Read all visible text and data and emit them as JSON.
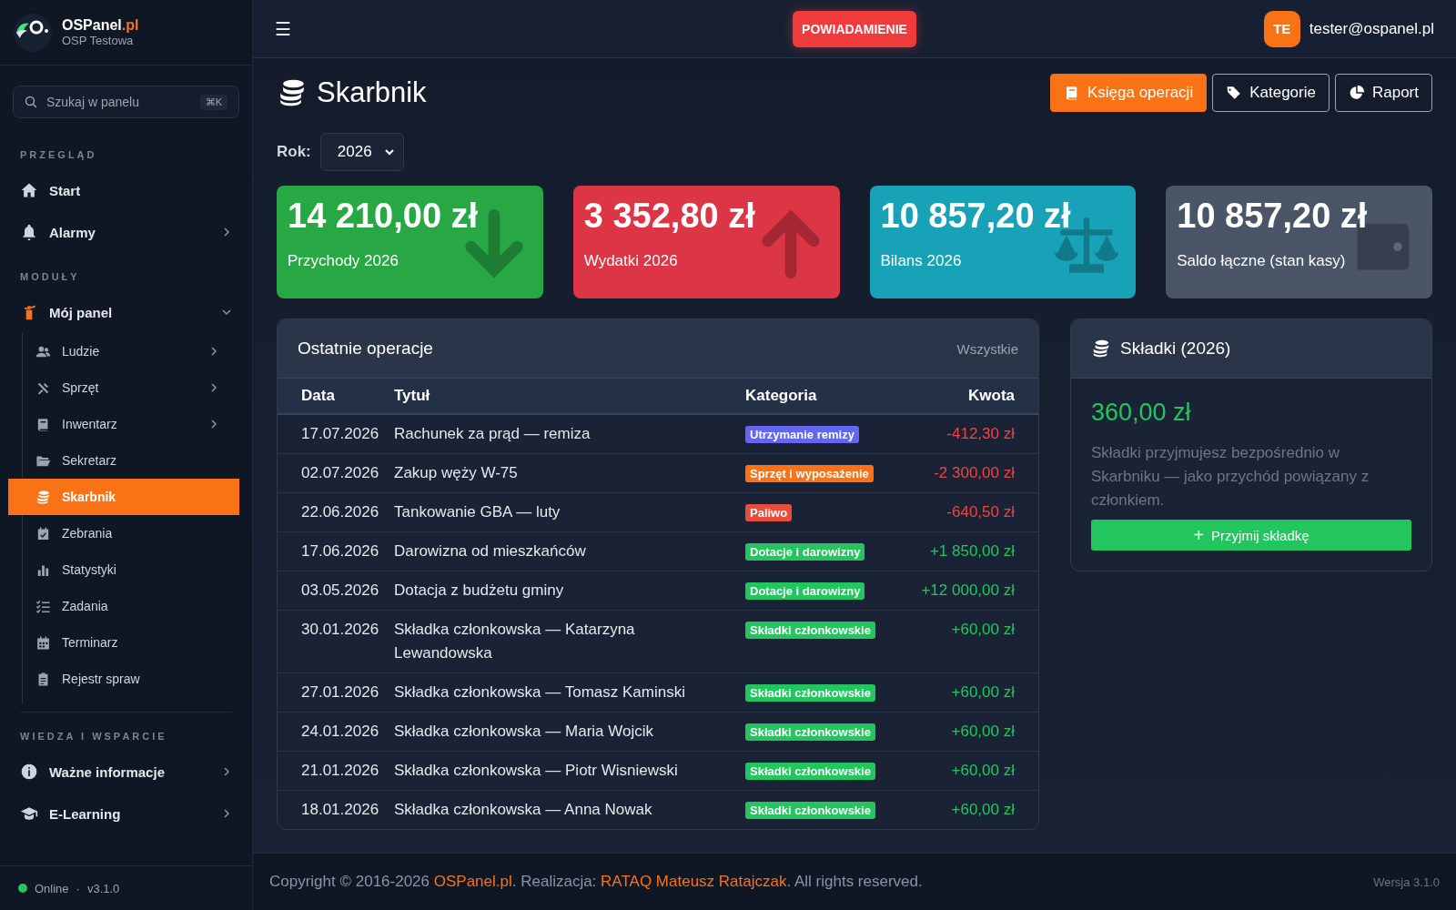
{
  "brand": {
    "name": "OSPanel",
    "tld": ".pl",
    "unit": "OSP Testowa"
  },
  "search": {
    "placeholder": "Szukaj w panelu",
    "shortcut": "⌘K"
  },
  "sidebar": {
    "sections": [
      {
        "heading": "PRZEGLĄD",
        "items": [
          {
            "label": "Start",
            "selected": false,
            "chevron": false
          },
          {
            "label": "Alarmy",
            "selected": false,
            "chevron": true
          }
        ]
      },
      {
        "heading": "MODUŁY",
        "items": [
          {
            "label": "Mój panel",
            "selected": false,
            "chevron": true,
            "expanded": true,
            "children": [
              {
                "label": "Ludzie",
                "selected": false,
                "chevron": true
              },
              {
                "label": "Sprzęt",
                "selected": false,
                "chevron": true
              },
              {
                "label": "Inwentarz",
                "selected": false,
                "chevron": true
              },
              {
                "label": "Sekretarz",
                "selected": false,
                "chevron": false
              },
              {
                "label": "Skarbnik",
                "selected": true,
                "chevron": false
              },
              {
                "label": "Zebrania",
                "selected": false,
                "chevron": false
              },
              {
                "label": "Statystyki",
                "selected": false,
                "chevron": false
              },
              {
                "label": "Zadania",
                "selected": false,
                "chevron": false
              },
              {
                "label": "Terminarz",
                "selected": false,
                "chevron": false
              },
              {
                "label": "Rejestr spraw",
                "selected": false,
                "chevron": false
              }
            ]
          }
        ]
      },
      {
        "heading": "WIEDZA I WSPARCIE",
        "items": [
          {
            "label": "Ważne informacje",
            "selected": false,
            "chevron": true
          },
          {
            "label": "E-Learning",
            "selected": false,
            "chevron": true
          }
        ]
      }
    ]
  },
  "status": {
    "label": "Online",
    "online": true,
    "separator": "·",
    "version": "v3.1.0"
  },
  "topbar": {
    "menu": "☰",
    "notification": "POWIADAMIENIE",
    "avatar": "TE",
    "user": "tester@ospanel.pl"
  },
  "page": {
    "title": "Skarbnik",
    "actions": [
      {
        "label": "Księga operacji",
        "primary": true
      },
      {
        "label": "Kategorie",
        "primary": false
      },
      {
        "label": "Raport",
        "primary": false
      }
    ],
    "year_label": "Rok:",
    "year": "2026"
  },
  "stats": [
    {
      "value": "14 210,00 zł",
      "label": "Przychody 2026",
      "color": "#28a745"
    },
    {
      "value": "3 352,80 zł",
      "label": "Wydatki 2026",
      "color": "#dc3545"
    },
    {
      "value": "10 857,20 zł",
      "label": "Bilans 2026",
      "color": "#17a2b8"
    },
    {
      "value": "10 857,20 zł",
      "label": "Saldo łączne (stan kasy)",
      "color": "#4a5568"
    }
  ],
  "operations": {
    "title": "Ostatnie operacje",
    "link": "Wszystkie",
    "columns": [
      "Data",
      "Tytuł",
      "Kategoria",
      "Kwota"
    ],
    "rows": [
      {
        "date": "17.07.2026",
        "title": "Rachunek za prąd — remiza",
        "category": "Utrzymanie remizy",
        "color": "#6366f1",
        "amount": "-412,30 zł",
        "kind": "expense"
      },
      {
        "date": "02.07.2026",
        "title": "Zakup węży W-75",
        "category": "Sprzęt i wyposażenie",
        "color": "#f97316",
        "amount": "-2 300,00 zł",
        "kind": "expense"
      },
      {
        "date": "22.06.2026",
        "title": "Tankowanie GBA — luty",
        "category": "Paliwo",
        "color": "#e74c3c",
        "amount": "-640,50 zł",
        "kind": "expense"
      },
      {
        "date": "17.06.2026",
        "title": "Darowizna od mieszkańców",
        "category": "Dotacje i darowizny",
        "color": "#22c55e",
        "amount": "+1 850,00 zł",
        "kind": "income"
      },
      {
        "date": "03.05.2026",
        "title": "Dotacja z budżetu gminy",
        "category": "Dotacje i darowizny",
        "color": "#22c55e",
        "amount": "+12 000,00 zł",
        "kind": "income"
      },
      {
        "date": "30.01.2026",
        "title": "Składka członkowska — Katarzyna Lewandowska",
        "category": "Składki członkowskie",
        "color": "#22c55e",
        "amount": "+60,00 zł",
        "kind": "income"
      },
      {
        "date": "27.01.2026",
        "title": "Składka członkowska — Tomasz Kaminski",
        "category": "Składki członkowskie",
        "color": "#22c55e",
        "amount": "+60,00 zł",
        "kind": "income"
      },
      {
        "date": "24.01.2026",
        "title": "Składka członkowska — Maria Wojcik",
        "category": "Składki członkowskie",
        "color": "#22c55e",
        "amount": "+60,00 zł",
        "kind": "income"
      },
      {
        "date": "21.01.2026",
        "title": "Składka członkowska — Piotr Wisniewski",
        "category": "Składki członkowskie",
        "color": "#22c55e",
        "amount": "+60,00 zł",
        "kind": "income"
      },
      {
        "date": "18.01.2026",
        "title": "Składka członkowska — Anna Nowak",
        "category": "Składki członkowskie",
        "color": "#22c55e",
        "amount": "+60,00 zł",
        "kind": "income"
      }
    ]
  },
  "dues": {
    "title": "Składki (2026)",
    "total": "360,00 zł",
    "note": "Składki przyjmujesz bezpośrednio w Skarbniku — jako przychód powiązany z członkiem.",
    "button_icon": "+",
    "button": "Przyjmij składkę"
  },
  "footer": {
    "parts": [
      {
        "kind": "text",
        "text": "Copyright © 2016-2026 "
      },
      {
        "kind": "link",
        "text": "OSPanel.pl"
      },
      {
        "kind": "text",
        "text": ". Realizacja: "
      },
      {
        "kind": "link",
        "text": "RATAQ Mateusz Ratajczak"
      },
      {
        "kind": "text",
        "text": ". All rights reserved."
      }
    ],
    "version": "Wersja 3.1.0"
  }
}
